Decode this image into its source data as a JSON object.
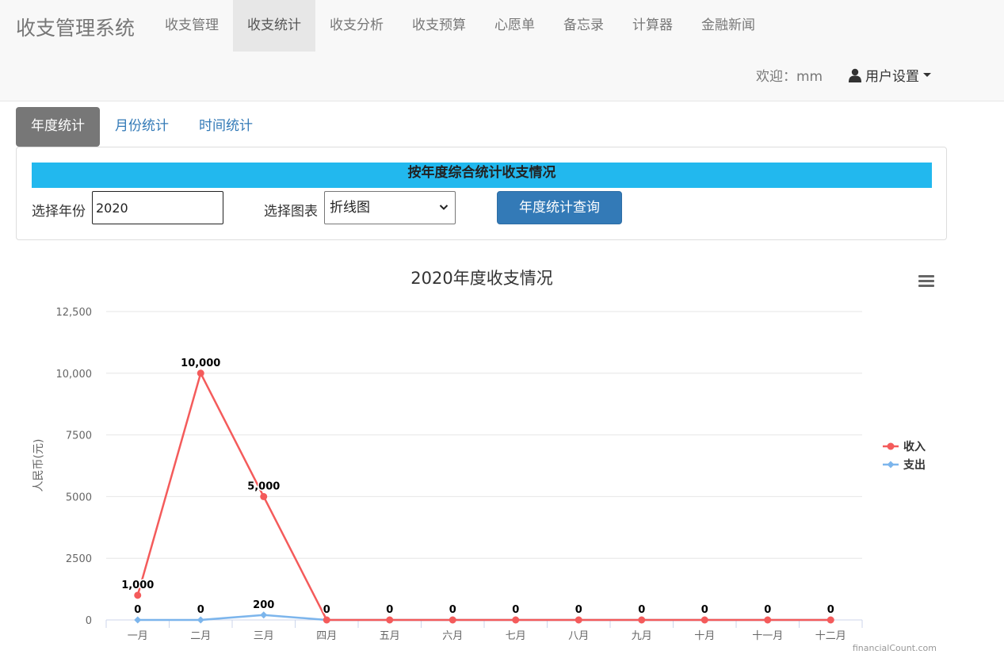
{
  "app": {
    "brand": "收支管理系统",
    "nav": [
      "收支管理",
      "收支统计",
      "收支分析",
      "收支预算",
      "心愿单",
      "备忘录",
      "计算器",
      "金融新闻"
    ],
    "active_nav": 1,
    "welcome": "欢迎：mm",
    "user_settings": "用户设置"
  },
  "tabs": {
    "items": [
      "年度统计",
      "月份统计",
      "时间统计"
    ],
    "active": 0
  },
  "panel": {
    "title": "按年度综合统计收支情况",
    "year_label": "选择年份",
    "year_value": "2020",
    "chart_label": "选择图表",
    "chart_value": "折线图",
    "query_button": "年度统计查询"
  },
  "chart_data": {
    "type": "line",
    "title": "2020年度收支情况",
    "ylabel": "人民币(元)",
    "categories": [
      "一月",
      "二月",
      "三月",
      "四月",
      "五月",
      "六月",
      "七月",
      "八月",
      "九月",
      "十月",
      "十一月",
      "十二月"
    ],
    "ylim": [
      0,
      12500
    ],
    "yticks": [
      0,
      2500,
      5000,
      7500,
      10000,
      12500
    ],
    "ytick_labels": [
      "0",
      "2500",
      "5000",
      "7500",
      "10,000",
      "12,500"
    ],
    "series": [
      {
        "name": "收入",
        "color": "#f45b5b",
        "marker": "circle",
        "values": [
          1000,
          10000,
          5000,
          0,
          0,
          0,
          0,
          0,
          0,
          0,
          0,
          0
        ],
        "labels": [
          "1,000",
          "10,000",
          "5,000",
          "0",
          "0",
          "0",
          "0",
          "0",
          "0",
          "0",
          "0",
          "0"
        ]
      },
      {
        "name": "支出",
        "color": "#7cb5ec",
        "marker": "diamond",
        "values": [
          0,
          0,
          200,
          0,
          0,
          0,
          0,
          0,
          0,
          0,
          0,
          0
        ],
        "labels": [
          "0",
          "0",
          "200",
          "0",
          "0",
          "0",
          "0",
          "0",
          "0",
          "0",
          "0",
          "0"
        ]
      }
    ],
    "legend": "right",
    "grid": true,
    "credits": "financialCount.com",
    "menu_icon": "hamburger-icon"
  }
}
